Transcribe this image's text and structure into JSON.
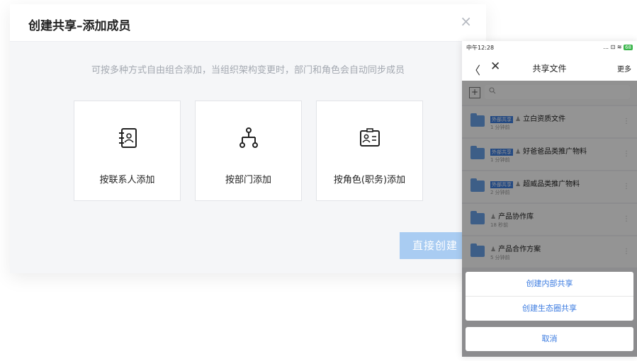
{
  "dialog": {
    "title": "创建共享–添加成员",
    "close_glyph": "×",
    "hint": "可按多种方式自由组合添加，当组织架构变更时，部门和角色会自动同步成员",
    "options": [
      {
        "label": "按联系人添加",
        "icon": "contacts-book-icon"
      },
      {
        "label": "按部门添加",
        "icon": "org-tree-icon"
      },
      {
        "label": "按角色(职务)添加",
        "icon": "id-card-icon"
      }
    ],
    "direct_button": "直接创建"
  },
  "phone": {
    "status": {
      "time": "中午12:28",
      "right": "... ⊡ ≋",
      "battery": "68"
    },
    "nav": {
      "back": "〈",
      "close": "✕",
      "title": "共享文件",
      "more": "更多"
    },
    "files": [
      {
        "tag": "外部共享",
        "name": "立白资质文件",
        "time": "1 分钟前"
      },
      {
        "tag": "外部共享",
        "name": "好爸爸品类推广物料",
        "time": "1 分钟前"
      },
      {
        "tag": "外部共享",
        "name": "超威品类推广物料",
        "time": "2 分钟前"
      },
      {
        "tag": "",
        "name": "产品协作库",
        "time": "18 秒前"
      },
      {
        "tag": "",
        "name": "产品合作方案",
        "time": "5 分钟前"
      }
    ],
    "sheet": {
      "items": [
        "创建内部共享",
        "创建生态圈共享"
      ],
      "cancel": "取消"
    }
  },
  "colors": {
    "accent": "#3b7be0",
    "button_disabled": "#a9ccf2",
    "tag": "#3d7fe0",
    "folder": "#6aa3e8"
  }
}
